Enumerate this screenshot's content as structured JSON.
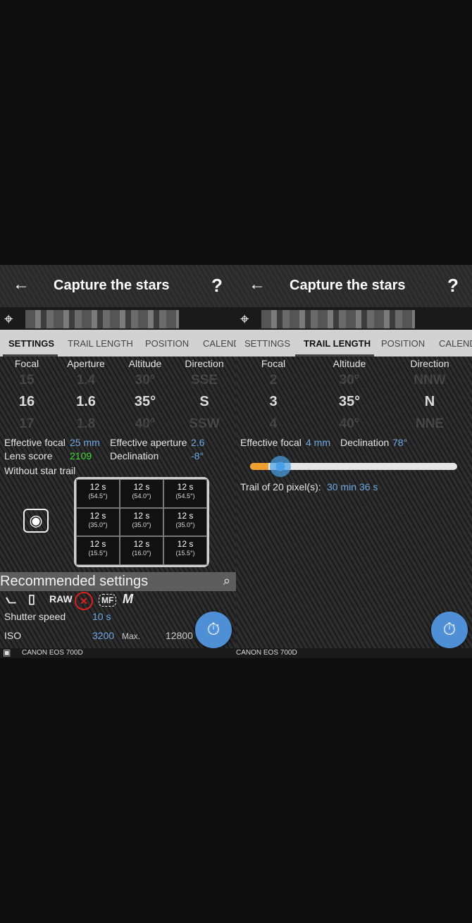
{
  "left": {
    "app_title": "Capture the stars",
    "back_icon": "arrow-left-icon",
    "help_label": "?",
    "tabs": [
      "SETTINGS",
      "TRAIL LENGTH",
      "POSITION",
      "CALEND"
    ],
    "active_tab": "SETTINGS",
    "columns": {
      "headers": [
        "Focal",
        "Aperture",
        "Altitude",
        "Direction"
      ],
      "above": [
        "15",
        "1.4",
        "30°",
        "SSE"
      ],
      "selected": [
        "16",
        "1.6",
        "35°",
        "S"
      ],
      "below": [
        "17",
        "1.8",
        "40°",
        "SSW"
      ]
    },
    "info": {
      "effective_focal_label": "Effective focal",
      "effective_focal_value": "25 mm",
      "effective_aperture_label": "Effective aperture",
      "effective_aperture_value": "2.6",
      "lens_score_label": "Lens score",
      "lens_score_value": "2109",
      "declination_label": "Declination",
      "declination_value": "-8°",
      "without_trail_label": "Without star trail"
    },
    "grid": [
      {
        "time": "12 s",
        "angle": "(54.5°)"
      },
      {
        "time": "12 s",
        "angle": "(54.0°)"
      },
      {
        "time": "12 s",
        "angle": "(54.5°)"
      },
      {
        "time": "12 s",
        "angle": "(35.0°)"
      },
      {
        "time": "12 s",
        "angle": "(35.0°)"
      },
      {
        "time": "12 s",
        "angle": "(35.0°)"
      },
      {
        "time": "12 s",
        "angle": "(15.5°)"
      },
      {
        "time": "12 s",
        "angle": "(16.0°)"
      },
      {
        "time": "12 s",
        "angle": "(15.5°)"
      }
    ],
    "recommended": {
      "title": "Recommended settings",
      "icons": [
        "tripod-icon",
        "remote-icon",
        "raw-icon",
        "no-flash-icon",
        "manual-focus-icon",
        "manual-mode-icon"
      ],
      "raw_label": "RAW",
      "mf_label": "MF",
      "m_label": "M",
      "shutter_label": "Shutter speed",
      "shutter_value": "10 s",
      "iso_label": "ISO",
      "iso_value": "3200",
      "max_label": "Max.",
      "max_value": "12800"
    },
    "camera": "CANON EOS 700D"
  },
  "right": {
    "app_title": "Capture the stars",
    "help_label": "?",
    "tabs": [
      "SETTINGS",
      "TRAIL LENGTH",
      "POSITION",
      "CALEND"
    ],
    "active_tab": "TRAIL LENGTH",
    "columns": {
      "headers": [
        "Focal",
        "Altitude",
        "Direction"
      ],
      "above": [
        "2",
        "30°",
        "NNW"
      ],
      "selected": [
        "3",
        "35°",
        "N"
      ],
      "below": [
        "4",
        "40°",
        "NNE"
      ]
    },
    "effective_focal_label": "Effective focal",
    "effective_focal_value": "4 mm",
    "declination_label": "Declination",
    "declination_value": "78°",
    "slider_fraction": 0.09,
    "trail_label": "Trail of 20 pixel(s):",
    "trail_value": "30 min 36 s",
    "camera": "CANON EOS 700D"
  },
  "colors": {
    "accent_blue": "#6ea9e6",
    "lens_score_green": "#44d83a",
    "fab_blue": "#4e8fd6",
    "slider_orange": "#f0a030"
  }
}
